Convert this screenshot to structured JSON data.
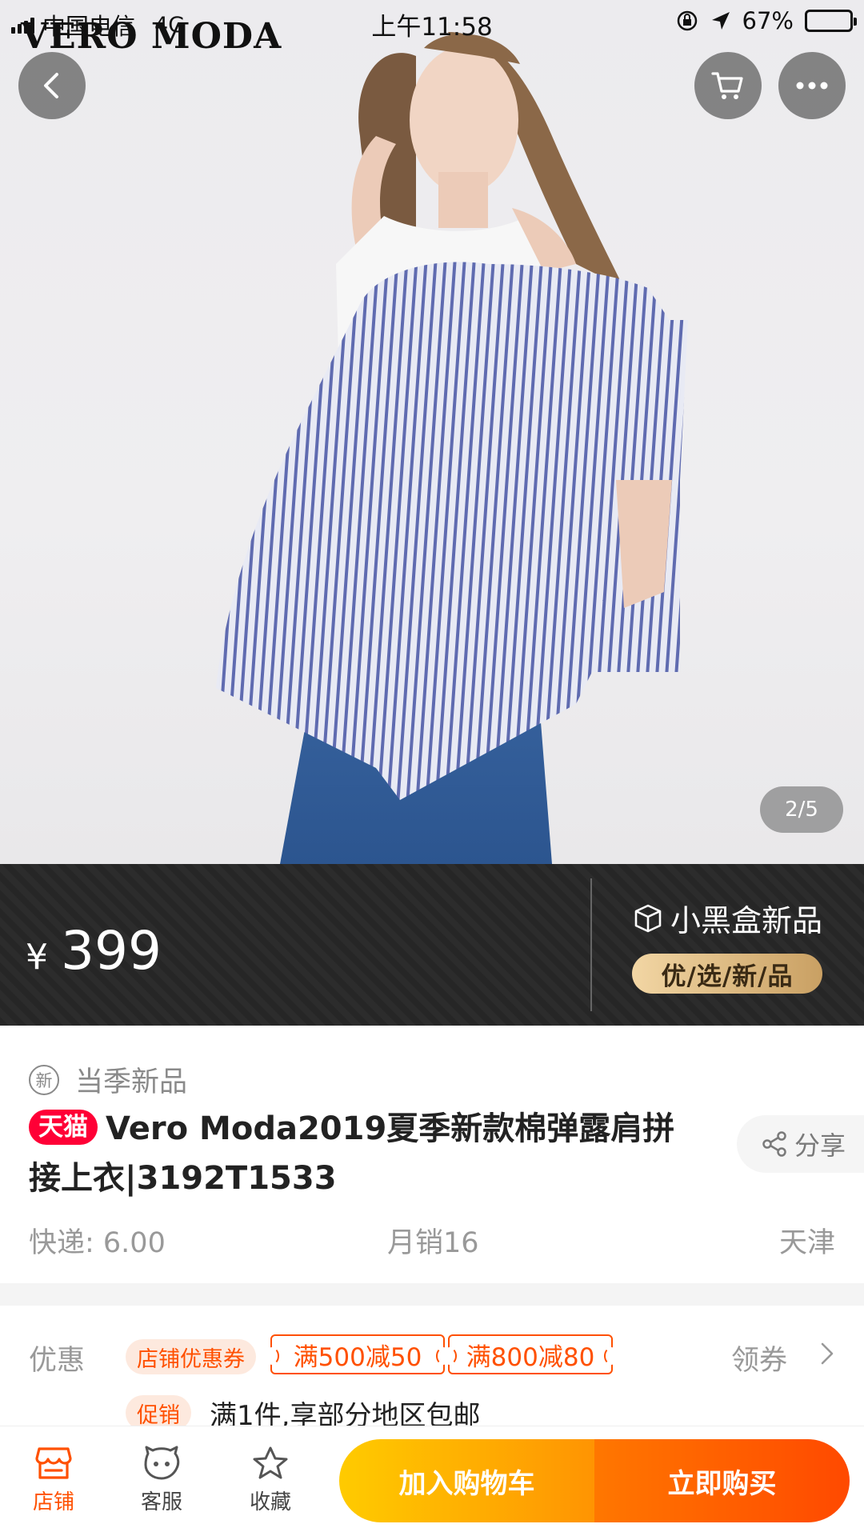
{
  "status_bar": {
    "carrier": "中国电信",
    "network": "4G",
    "time": "上午11:58",
    "battery": "67%",
    "battery_level": 0.67
  },
  "hero": {
    "brand_logo": "VERO MODA",
    "pager": "2/5",
    "icons": [
      "back-icon",
      "cart-icon",
      "more-icon"
    ]
  },
  "price_band": {
    "currency": "¥",
    "price": "399",
    "badge_title": "小黑盒新品",
    "badge_tagline": "优/选/新/品"
  },
  "product": {
    "season_mark": "新",
    "season_label": "当季新品",
    "platform_tag": "天猫",
    "title": "Vero Moda2019夏季新款棉弹露肩拼接上衣|3192T1533",
    "share_label": "分享",
    "shipping": "快递: 6.00",
    "monthly_sales": "月销16",
    "location": "天津"
  },
  "offers": {
    "label": "优惠",
    "shop_coupon": "店铺优惠券",
    "coupons": [
      "满500减50",
      "满800减80"
    ],
    "get_coupon": "领券",
    "promo_tag": "促销",
    "promo_text": "满1件,享部分地区包邮"
  },
  "bottom_bar": {
    "shop": "店铺",
    "service": "客服",
    "favorite": "收藏",
    "add_to_cart": "加入购物车",
    "buy_now": "立即购买"
  },
  "colors": {
    "accent_orange": "#ff5000",
    "tmall_red": "#ff0036",
    "cart_gradient": [
      "#ffcb00",
      "#ff9402"
    ],
    "buy_gradient": [
      "#ff7700",
      "#ff4900"
    ],
    "gold": "#d9b77c"
  }
}
